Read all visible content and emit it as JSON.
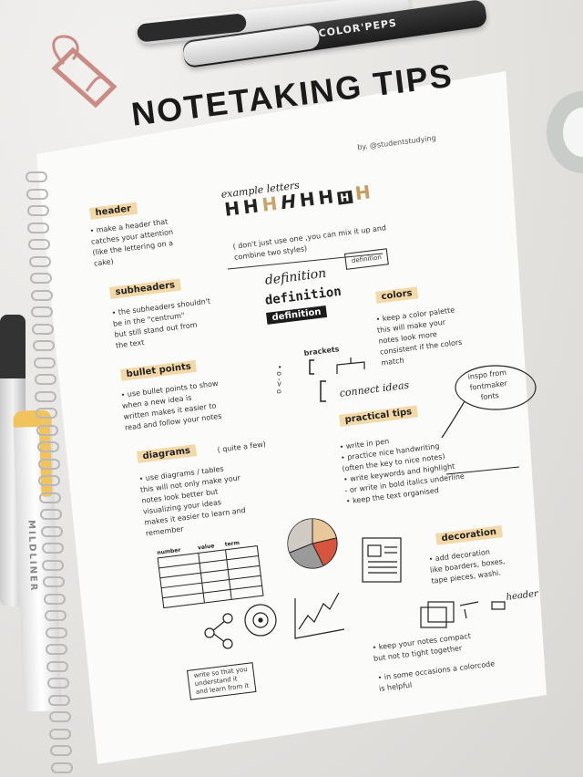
{
  "desk": {
    "pen_brand": "COLOR'PEPS",
    "highlighter_text": "MILDLINER"
  },
  "page": {
    "title": "NOTETAKING TIPS",
    "byline": "by. @studentstudying",
    "header_label": "header",
    "header_text": "• make a header that\ncatches your attention\n(like the lettering on a\ncake)",
    "example_letters_label": "example letters",
    "example_letters": [
      "H",
      "H",
      "H",
      "H",
      "H",
      "H",
      "H",
      "H"
    ],
    "example_note": "( don't just use one ,you can mix it up and\ncombine two styles)",
    "definition_small": "definition",
    "subheaders_label": "subheaders",
    "subheaders_text": "• the subheaders shouldn't\nbe in the \"centrum\"\nbut still stand out from\nthe text",
    "definition_script": "definition",
    "definition_bold": "definition",
    "definition_inverse": "definition",
    "colors_label": "colors",
    "colors_text": "• keep a color palette\nthis will make your\nnotes look more\nconsistent if the colors\nmatch",
    "brackets_label": "brackets",
    "connect_ideas": "connect ideas",
    "bullet_points_label": "bullet points",
    "bullet_points_text": "• use bullet points to show\nwhen a new idea is\nwritten makes it easier to\nread and follow your notes",
    "arrows_label": "• o -> o",
    "practical_tips_label": "practical tips",
    "inspo": "inspo from\nfontmaker\nfonts",
    "diagrams_label": "diagrams",
    "diagrams_note": "( quite a few)",
    "diagrams_text": "• use diagrams / tables\nthis will not only make your\nnotes look better but\nvisualizing your ideas\nmakes it easier to learn and\nremember",
    "practical_tips_text": "• write in pen\n• practice nice handwriting\n(often the key to nice notes)\n• write keywords and highlight\n- or write in bold italics underline\n• keep the text organised",
    "table_headers": [
      "number",
      "value",
      "term"
    ],
    "decoration_label": "decoration",
    "decoration_text": "• add decoration\nlike boarders, boxes,\ntape pieces, washi.",
    "header_tag": "header",
    "compact_text": "• keep your notes compact\nbut not to tight together",
    "colorcode_text": "• in some occasions a colorcode\nis helpful",
    "write_box": "write so that you\nunderstand it\nand learn from it"
  },
  "colors": {
    "highlight": "#f4d9a8",
    "ink": "#1c1c1c",
    "paper": "#fbfbfa",
    "pie_red": "#d7553f",
    "pie_tan": "#e8c89a",
    "pie_gray": "#9a9a9a"
  },
  "icons": [
    "binder-clip-icon",
    "washi-tape-icon",
    "spiral-binding-icon"
  ]
}
